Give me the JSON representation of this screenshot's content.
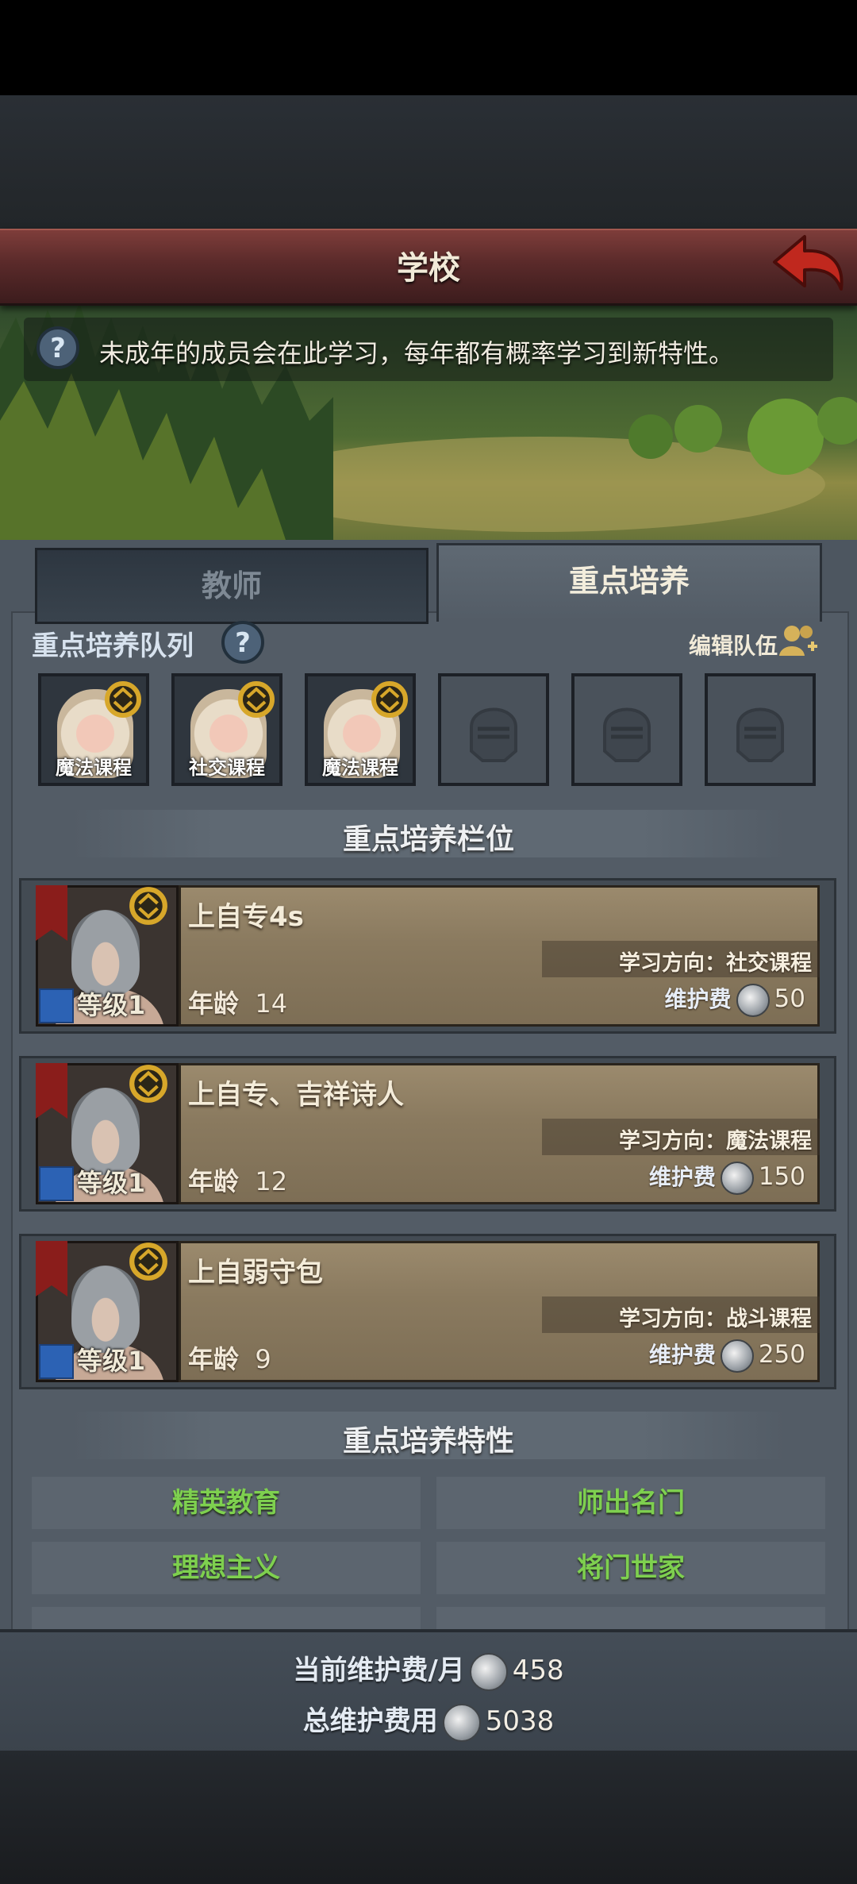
{
  "header": {
    "title": "学校"
  },
  "banner": {
    "hint": "未成年的成员会在此学习，每年都有概率学习到新特性。"
  },
  "tabs": [
    {
      "label": "教师"
    },
    {
      "label": "重点培养"
    }
  ],
  "queue": {
    "label": "重点培养队列",
    "edit_label": "编辑队伍",
    "slots": [
      {
        "course": "魔法课程"
      },
      {
        "course": "社交课程"
      },
      {
        "course": "魔法课程"
      }
    ]
  },
  "slots_section": {
    "title": "重点培养栏位"
  },
  "members": [
    {
      "name": "上自专4s",
      "level": "等级1",
      "age_label": "年龄",
      "age": "14",
      "direction": "学习方向：社交课程",
      "fee_label": "维护费",
      "fee": "50"
    },
    {
      "name": "上自专、吉祥诗人",
      "level": "等级1",
      "age_label": "年龄",
      "age": "12",
      "direction": "学习方向：魔法课程",
      "fee_label": "维护费",
      "fee": "150"
    },
    {
      "name": "上自弱守包",
      "level": "等级1",
      "age_label": "年龄",
      "age": "9",
      "direction": "学习方向：战斗课程",
      "fee_label": "维护费",
      "fee": "250"
    }
  ],
  "traits_section": {
    "title": "重点培养特性",
    "items": [
      "精英教育",
      "师出名门",
      "理想主义",
      "将门世家"
    ]
  },
  "summary": {
    "monthly_label": "当前维护费/月",
    "monthly_value": "458",
    "total_label": "总维护费用",
    "total_value": "5038"
  },
  "colors": {
    "trait_green": "#7ed04f",
    "title_red": "#6b3130"
  }
}
